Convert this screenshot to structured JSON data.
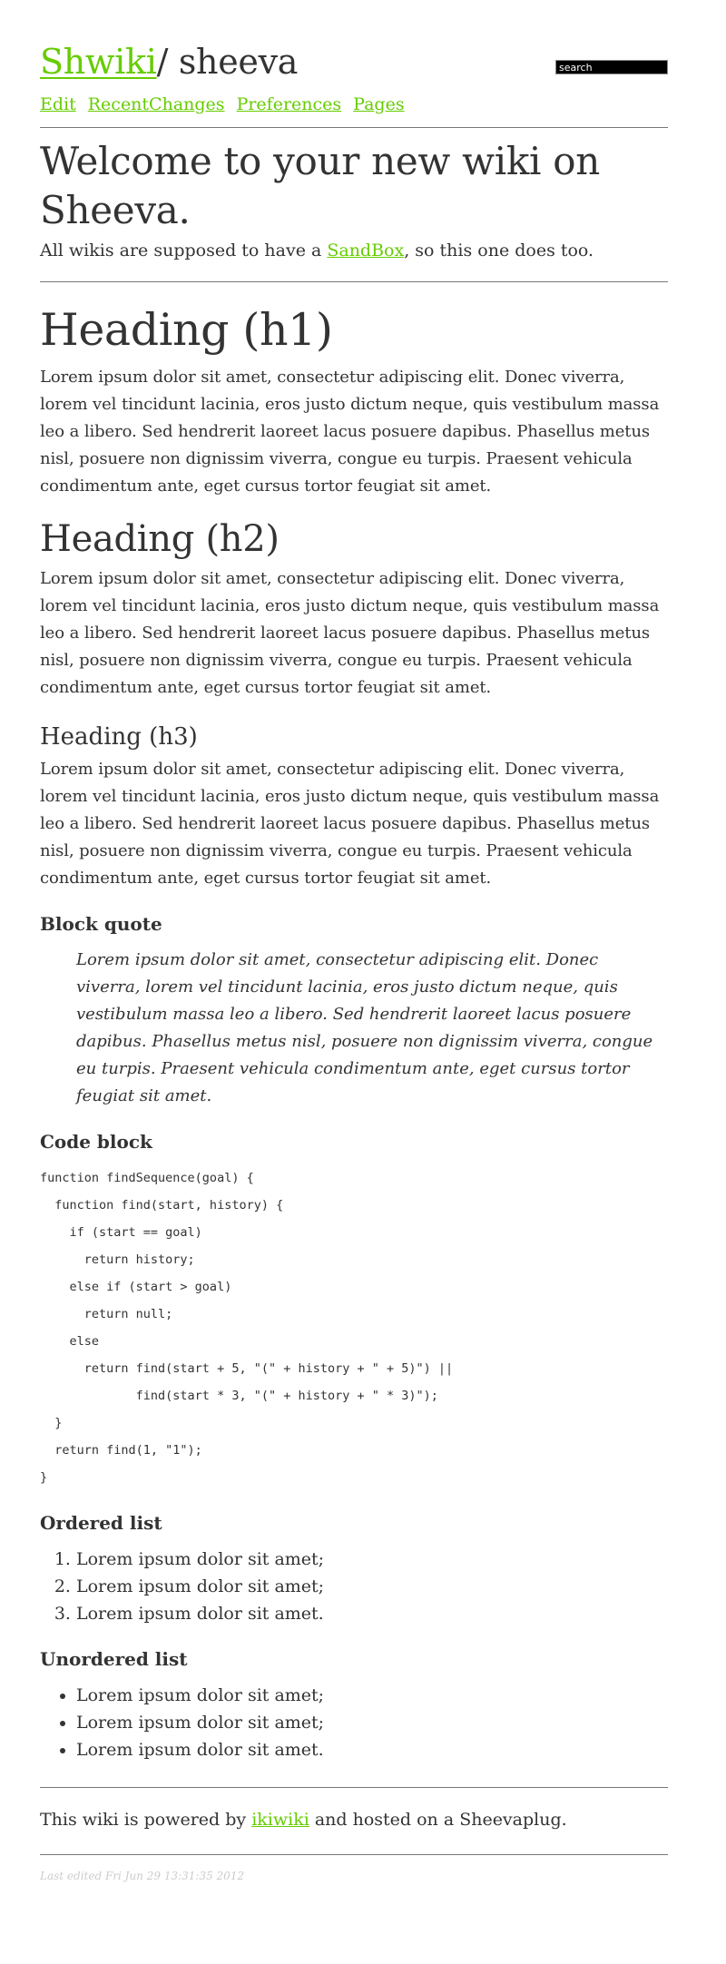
{
  "header": {
    "site_link": "Shwiki",
    "site_rest": "/ sheeva",
    "search_placeholder": "search"
  },
  "actions": [
    "Edit",
    "RecentChanges",
    "Preferences",
    "Pages"
  ],
  "page_title": "Welcome to your new wiki on Sheeva.",
  "intro": {
    "before": "All wikis are supposed to have a ",
    "link": "SandBox",
    "after": ", so this one does too."
  },
  "content": {
    "h1": "Heading (h1)",
    "h2": "Heading (h2)",
    "h3": "Heading (h3)",
    "lorem": "Lorem ipsum dolor sit amet, consectetur adipiscing elit. Donec viverra, lorem vel tincidunt lacinia, eros justo dictum neque, quis vestibulum massa leo a libero. Sed hendrerit laoreet lacus posuere dapibus. Phasellus metus nisl, posuere non dignissim viverra, congue eu turpis. Praesent vehicula condimentum ante, eget cursus tortor feugiat sit amet.",
    "blockquote_heading": "Block quote",
    "blockquote": "Lorem ipsum dolor sit amet, consectetur adipiscing elit. Donec viverra, lorem vel tincidunt lacinia, eros justo dictum neque, quis vestibulum massa leo a libero. Sed hendrerit laoreet lacus posuere dapibus. Phasellus metus nisl, posuere non dignissim viverra, congue eu turpis. Praesent vehicula condimentum ante, eget cursus tortor feugiat sit amet.",
    "code_heading": "Code block",
    "code": "function findSequence(goal) {\n  function find(start, history) {\n    if (start == goal)\n      return history;\n    else if (start > goal)\n      return null;\n    else\n      return find(start + 5, \"(\" + history + \" + 5)\") ||\n             find(start * 3, \"(\" + history + \" * 3)\");\n  }\n  return find(1, \"1\");\n}",
    "ordered_heading": "Ordered list",
    "ordered": [
      "Lorem ipsum dolor sit amet;",
      "Lorem ipsum dolor sit amet;",
      "Lorem ipsum dolor sit amet."
    ],
    "unordered_heading": "Unordered list",
    "unordered": [
      "Lorem ipsum dolor sit amet;",
      "Lorem ipsum dolor sit amet;",
      "Lorem ipsum dolor sit amet."
    ]
  },
  "footer": {
    "before": "This wiki is powered by ",
    "link": "ikiwiki",
    "after": " and hosted on a Sheevaplug.",
    "last_edited": "Last edited Fri Jun 29 13:31:35 2012"
  },
  "colors": {
    "link": "#66cc00",
    "text": "#333333",
    "search_bg": "#000000",
    "last_edited": "#cccccc"
  }
}
